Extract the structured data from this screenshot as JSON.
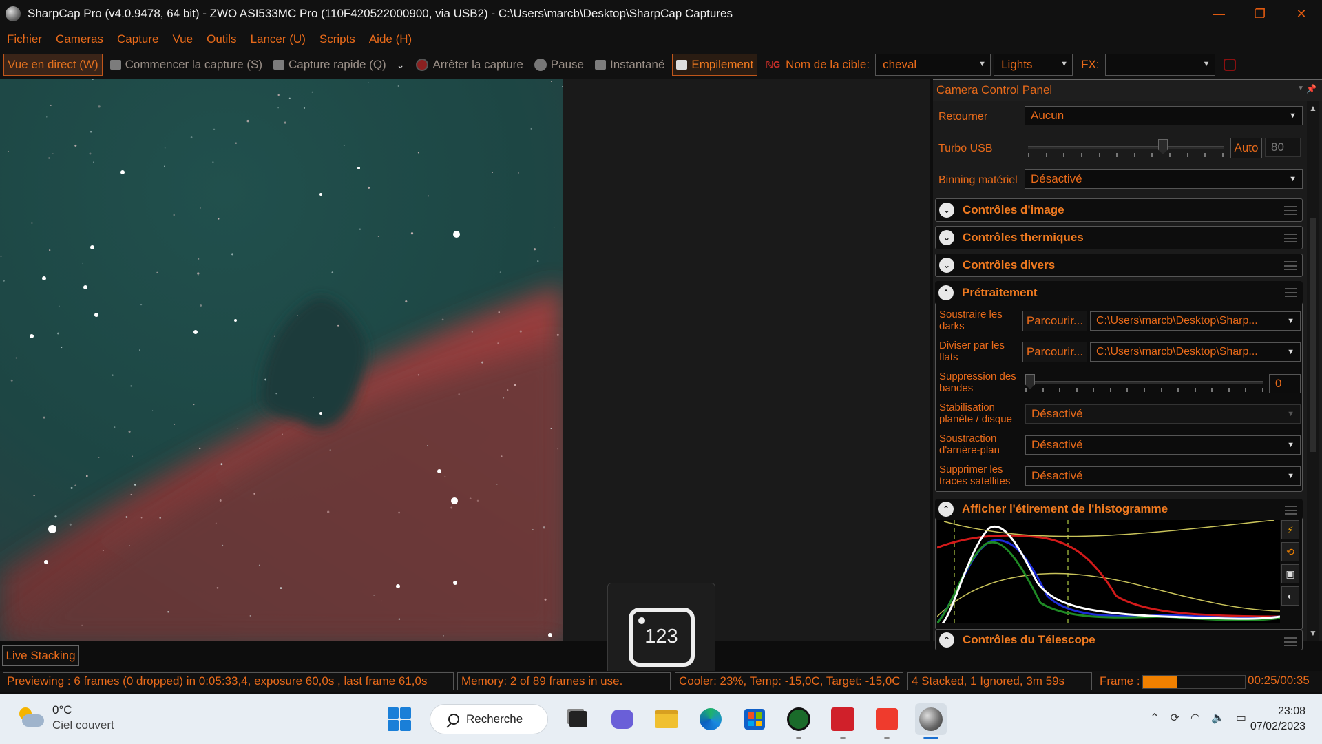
{
  "titlebar": {
    "title": "SharpCap Pro (v4.0.9478, 64 bit) - ZWO ASI533MC Pro (110F420522000900, via USB2) - C:\\Users\\marcb\\Desktop\\SharpCap Captures",
    "minimize": "—",
    "maximize": "❐",
    "close": "✕"
  },
  "menu": [
    "Fichier",
    "Cameras",
    "Capture",
    "Vue",
    "Outils",
    "Lancer (U)",
    "Scripts",
    "Aide (H)"
  ],
  "toolbar": {
    "live_view": "Vue en direct (W)",
    "start_capture": "Commencer la capture (S)",
    "quick_capture": "Capture rapide (Q)",
    "stop_capture": "Arrêter la capture",
    "pause": "Pause",
    "snapshot": "Instantané",
    "stacking": "Empilement",
    "target_label": "Nom de la cible:",
    "target_value": "cheval",
    "frame_type": "Lights",
    "fx_label": "FX:",
    "fx_value": ""
  },
  "counter_overlay": {
    "value": "123"
  },
  "panel": {
    "header": "Camera Control Panel",
    "retourner": {
      "label": "Retourner",
      "value": "Aucun"
    },
    "turbo": {
      "label": "Turbo USB",
      "auto": "Auto",
      "value": "80",
      "level": 0.7
    },
    "binning": {
      "label": "Binning matériel",
      "value": "Désactivé"
    },
    "sections": [
      "Contrôles d'image",
      "Contrôles thermiques",
      "Contrôles divers"
    ],
    "pretraitement": {
      "title": "Prétraitement",
      "darks_label": "Soustraire les darks",
      "darks_button": "Parcourir...",
      "darks_path": "C:\\Users\\marcb\\Desktop\\Sharp...",
      "flats_label": "Diviser par les flats",
      "flats_button": "Parcourir...",
      "flats_path": "C:\\Users\\marcb\\Desktop\\Sharp...",
      "banding_label": "Suppression des bandes",
      "banding_value": "0",
      "stab_label": "Stabilisation planète / disque",
      "stab_value": "Désactivé",
      "bg_label": "Soustraction d'arrière-plan",
      "bg_value": "Désactivé",
      "sat_label": "Supprimer les traces satellites",
      "sat_value": "Désactivé"
    },
    "histogram": {
      "title": "Afficher l'étirement de l'histogramme"
    },
    "telescope": {
      "title": "Contrôles du Télescope"
    }
  },
  "live_stacking_tab": "Live Stacking",
  "status": {
    "preview": "Previewing : 6 frames (0 dropped) in 0:05:33,4, exposure 60,0s , last frame 61,0s",
    "memory": "Memory: 2 of 89 frames in use.",
    "cooler": "Cooler: 23%, Temp: -15,0C, Target: -15,0C",
    "stacked": "4 Stacked, 1 Ignored, 3m 59s",
    "frame_label": "Frame :",
    "frame_progress": 0.33,
    "frame_time": "00:25/00:35"
  },
  "taskbar": {
    "weather_temp": "0°C",
    "weather_desc": "Ciel couvert",
    "search": "Recherche",
    "time": "23:08",
    "date": "07/02/2023"
  },
  "colors": {
    "accent": "#e86a1a",
    "stars": "#ffffff",
    "nebula": "#a13a38",
    "sky": "#1f4a47"
  }
}
